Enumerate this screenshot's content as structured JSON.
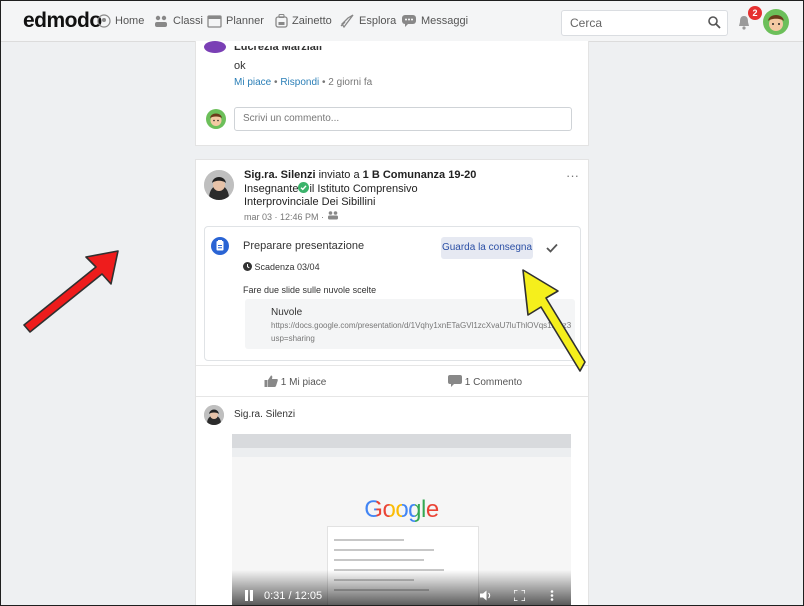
{
  "nav": {
    "brand": "edmodo",
    "items": [
      "Home",
      "Classi",
      "Planner",
      "Zainetto",
      "Esplora",
      "Messaggi"
    ],
    "search_placeholder": "Cerca",
    "notification_count": "2"
  },
  "comment": {
    "author": "Lucrezia Marziali",
    "text": "ok",
    "like_label": "Mi piace",
    "reply_label": "Rispondi",
    "time": "2 giorni fa",
    "input_placeholder": "Scrivi un commento..."
  },
  "post": {
    "author": "Sig.ra. Silenzi",
    "sent_to_label": "inviato a",
    "group": "1 B Comunanza 19-20",
    "role": "Insegnante",
    "school": "il Istituto Comprensivo Interprovinciale Dei Sibillini",
    "date": "mar 03 · 12:46 PM ·",
    "more": "···",
    "assignment": {
      "title": "Preparare presentazione",
      "button": "Guarda la consegna",
      "due": "Scadenza 03/04",
      "description": "Fare due slide sulle nuvole scelte",
      "link_title": "Nuvole",
      "link_url_1": "https://docs.google.com/presentation/d/1Vqhy1xnETaGVl1zcXvaU7luThlOVqs1M8z3",
      "link_url_2": "usp=sharing"
    },
    "likes": "1 Mi piace",
    "comments": "1 Commento",
    "reply_author": "Sig.ra. Silenzi",
    "video": {
      "time": "0:31 / 12:05",
      "progress": 0.04,
      "logo_text": "Google"
    }
  }
}
